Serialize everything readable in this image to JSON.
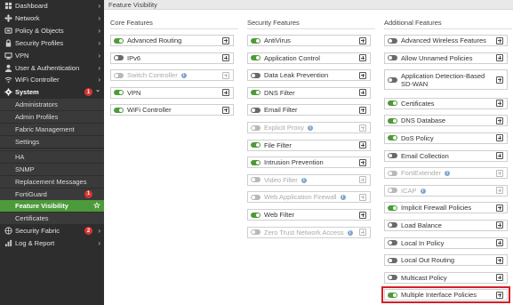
{
  "sidebar": {
    "items": [
      {
        "label": "Dashboard",
        "icon": "dashboard-icon",
        "has_arrow": true
      },
      {
        "label": "Network",
        "icon": "network-icon",
        "has_arrow": true
      },
      {
        "label": "Policy & Objects",
        "icon": "policy-icon",
        "has_arrow": true
      },
      {
        "label": "Security Profiles",
        "icon": "lock-icon",
        "has_arrow": true
      },
      {
        "label": "VPN",
        "icon": "vpn-icon",
        "has_arrow": true
      },
      {
        "label": "User & Authentication",
        "icon": "user-icon",
        "has_arrow": true
      },
      {
        "label": "WiFi Controller",
        "icon": "wifi-icon",
        "has_arrow": true
      },
      {
        "label": "System",
        "icon": "gear-icon",
        "badge": "1",
        "has_arrow": true
      },
      {
        "label": "Security Fabric",
        "icon": "fabric-icon",
        "badge": "2",
        "has_arrow": true
      },
      {
        "label": "Log & Report",
        "icon": "chart-icon",
        "has_arrow": true
      }
    ],
    "system_subitems": [
      {
        "label": "Administrators"
      },
      {
        "label": "Admin Profiles"
      },
      {
        "label": "Fabric Management"
      },
      {
        "label": "Settings"
      },
      {
        "label": "HA"
      },
      {
        "label": "SNMP"
      },
      {
        "label": "Replacement Messages"
      },
      {
        "label": "FortiGuard",
        "badge": "1"
      },
      {
        "label": "Feature Visibility",
        "active": true
      },
      {
        "label": "Certificates"
      }
    ]
  },
  "breadcrumb": "Feature Visibility",
  "columns": [
    {
      "title": "Core Features",
      "features": [
        {
          "label": "Advanced Routing",
          "state": "on"
        },
        {
          "label": "IPv6",
          "state": "off"
        },
        {
          "label": "Switch Controller",
          "state": "disabled",
          "info": true
        },
        {
          "label": "VPN",
          "state": "on"
        },
        {
          "label": "WiFi Controller",
          "state": "on"
        }
      ]
    },
    {
      "title": "Security Features",
      "features": [
        {
          "label": "AntiVirus",
          "state": "on"
        },
        {
          "label": "Application Control",
          "state": "on"
        },
        {
          "label": "Data Leak Prevention",
          "state": "off"
        },
        {
          "label": "DNS Filter",
          "state": "on"
        },
        {
          "label": "Email Filter",
          "state": "off"
        },
        {
          "label": "Explicit Proxy",
          "state": "disabled",
          "info": true
        },
        {
          "label": "File Filter",
          "state": "on"
        },
        {
          "label": "Intrusion Prevention",
          "state": "on"
        },
        {
          "label": "Video Filter",
          "state": "disabled",
          "info": true
        },
        {
          "label": "Web Application Firewall",
          "state": "disabled",
          "info": true
        },
        {
          "label": "Web Filter",
          "state": "on"
        },
        {
          "label": "Zero Trust Network Access",
          "state": "disabled",
          "info": true
        }
      ]
    },
    {
      "title": "Additional Features",
      "features": [
        {
          "label": "Advanced Wireless Features",
          "state": "off"
        },
        {
          "label": "Allow Unnamed Policies",
          "state": "off"
        },
        {
          "label": "Application Detection-Based SD-WAN",
          "state": "off",
          "tall": true
        },
        {
          "label": "Certificates",
          "state": "on"
        },
        {
          "label": "DNS Database",
          "state": "on"
        },
        {
          "label": "DoS Policy",
          "state": "on"
        },
        {
          "label": "Email Collection",
          "state": "off"
        },
        {
          "label": "FortiExtender",
          "state": "disabled",
          "info": true
        },
        {
          "label": "ICAP",
          "state": "disabled",
          "info": true
        },
        {
          "label": "Implicit Firewall Policies",
          "state": "on"
        },
        {
          "label": "Load Balance",
          "state": "off"
        },
        {
          "label": "Local In Policy",
          "state": "off"
        },
        {
          "label": "Local Out Routing",
          "state": "off"
        },
        {
          "label": "Multicast Policy",
          "state": "off"
        },
        {
          "label": "Multiple Interface Policies",
          "state": "on",
          "highlighted": true
        }
      ]
    }
  ],
  "colors": {
    "sidebar_bg": "#2d2d2d",
    "active_green": "#4d9a3b",
    "badge_red": "#d9352e",
    "highlight_red": "#d51f26"
  }
}
